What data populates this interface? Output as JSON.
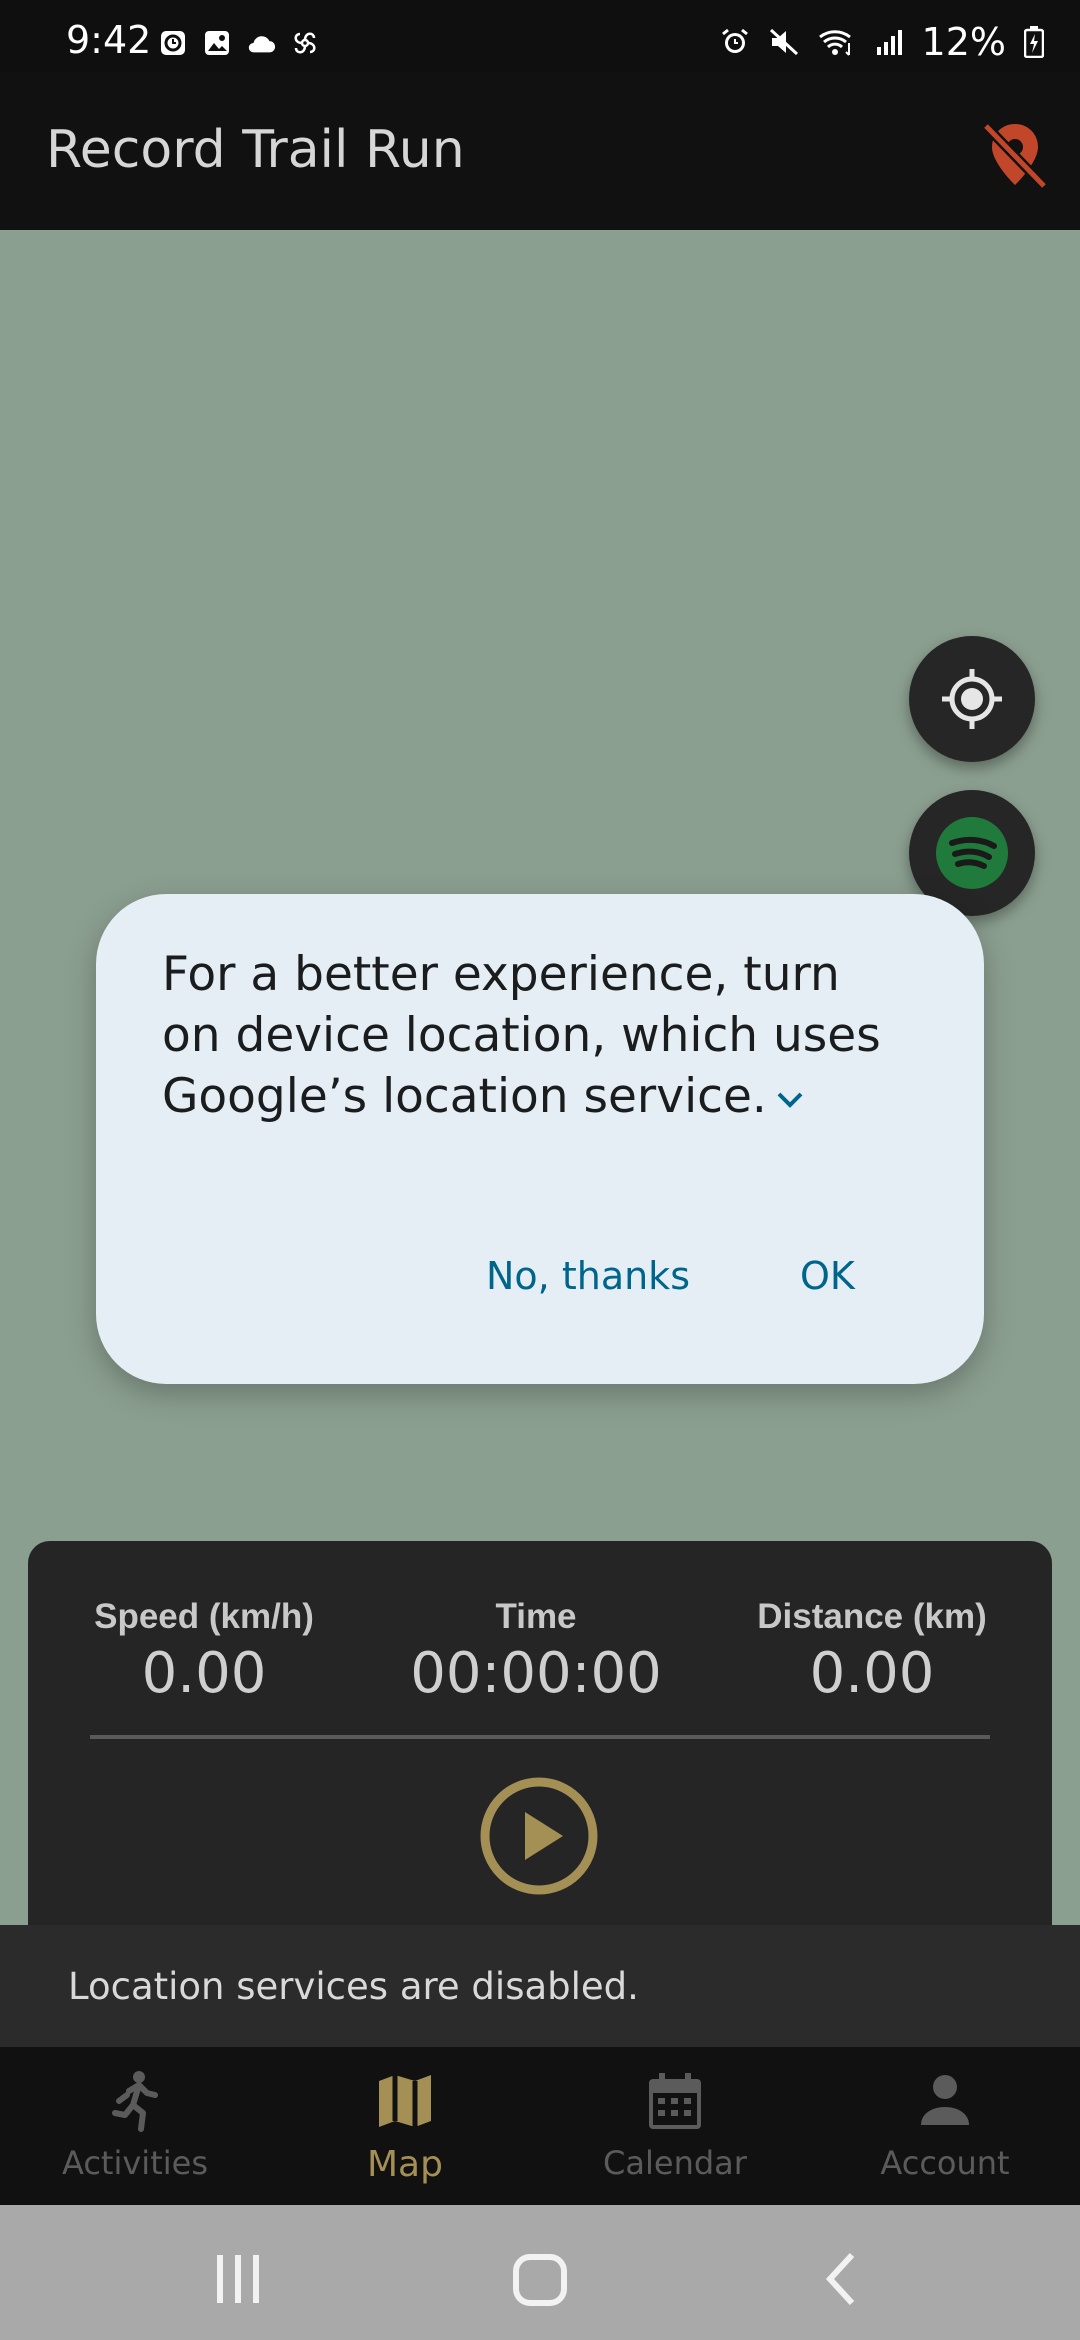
{
  "status_bar": {
    "time": "9:42",
    "battery": "12%"
  },
  "app_bar": {
    "title": "Record Trail Run"
  },
  "colors": {
    "accent": "#a48f55",
    "location_off": "#c2472a",
    "spotify": "#1db954"
  },
  "dialog": {
    "message": "For a better experience, turn on device location, which uses Google’s location service.",
    "no_label": "No, thanks",
    "ok_label": "OK"
  },
  "stats": {
    "speed": {
      "label": "Speed (km/h)",
      "value": "0.00"
    },
    "time": {
      "label": "Time",
      "value": "00:00:00"
    },
    "distance": {
      "label": "Distance (km)",
      "value": "0.00"
    }
  },
  "snackbar": {
    "text": "Location services are disabled."
  },
  "bottom_nav": {
    "items": [
      {
        "label": "Activities",
        "icon": "run-icon"
      },
      {
        "label": "Map",
        "icon": "map-icon",
        "active": true
      },
      {
        "label": "Calendar",
        "icon": "calendar-icon"
      },
      {
        "label": "Account",
        "icon": "person-icon"
      }
    ]
  }
}
